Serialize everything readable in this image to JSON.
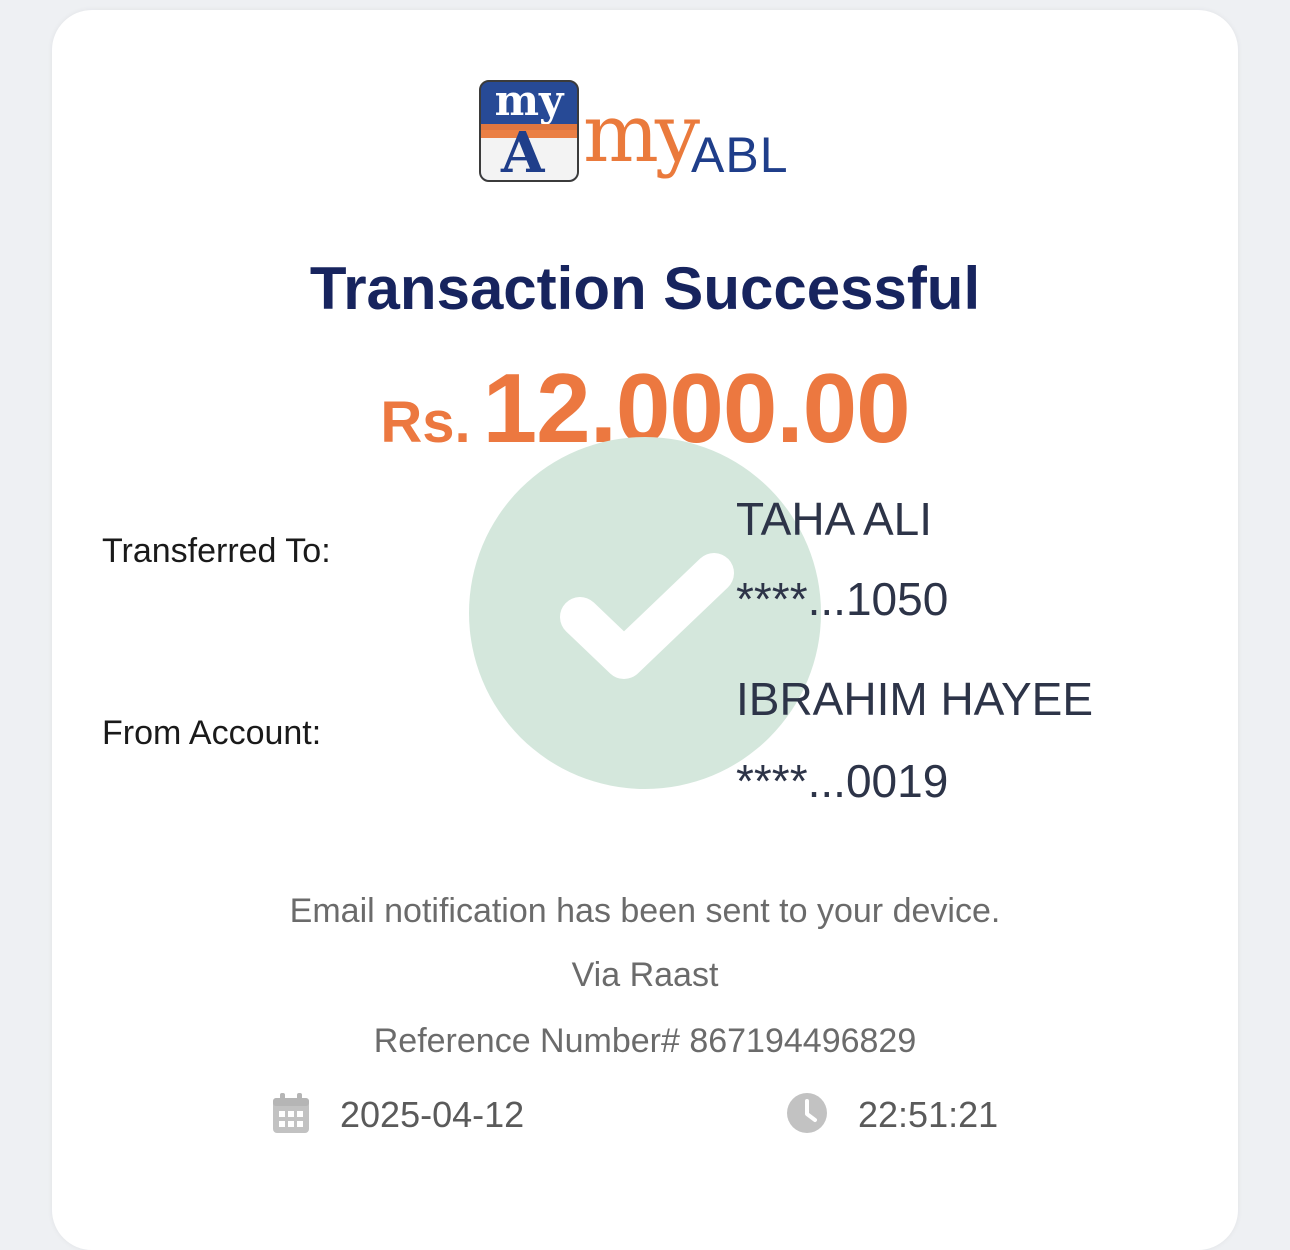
{
  "logo": {
    "badge_text": "my",
    "badge_letter": "A",
    "wordmark_my": "my",
    "wordmark_abl": "ABL"
  },
  "title": "Transaction Successful",
  "amount": {
    "currency": "Rs.",
    "value": "12,000.00"
  },
  "transfer": {
    "to_label": "Transferred To:",
    "to_name": "TAHA ALI",
    "to_account": "****...1050",
    "from_label": "From Account:",
    "from_name": "IBRAHIM HAYEE",
    "from_account": "****...0019"
  },
  "notification": "Email notification has been sent to your device.",
  "via": "Via Raast",
  "reference": "Reference Number# 867194496829",
  "date": "2025-04-12",
  "time": "22:51:21",
  "icons": {
    "success": "checkmark-icon",
    "date": "calendar-icon",
    "time": "clock-icon"
  },
  "colors": {
    "title": "#17245e",
    "amount": "#ec7840",
    "check_circle": "#d4e7dc"
  }
}
